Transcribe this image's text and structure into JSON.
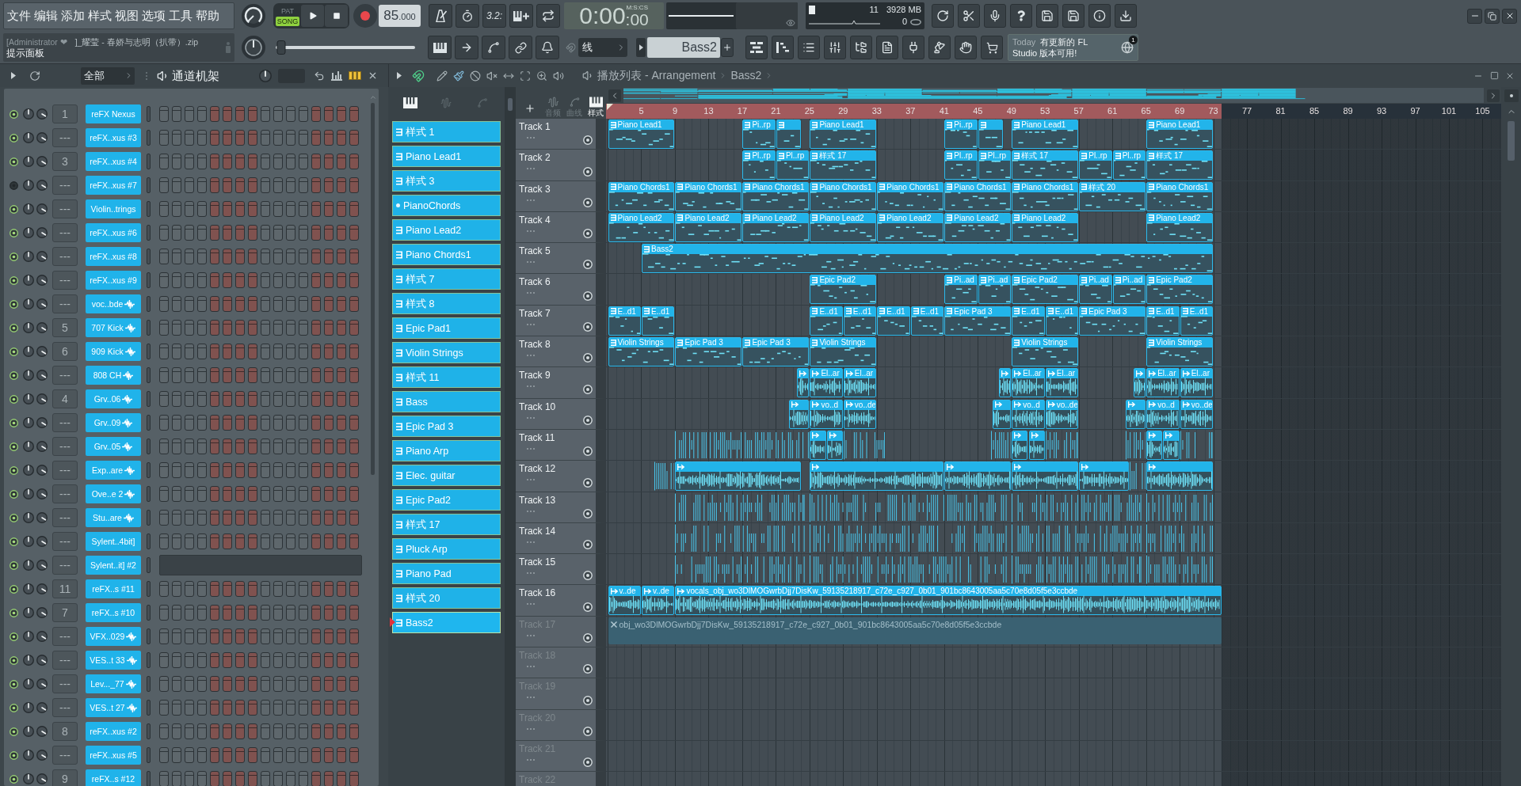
{
  "menu": [
    "文件",
    "编辑",
    "添加",
    "样式",
    "视图",
    "选项",
    "工具",
    "帮助"
  ],
  "hint_panel": {
    "user": "[Administrator ❤",
    "file": "]_耀莹 - 春娇与志明（扒带）.zip",
    "title": "提示面板"
  },
  "transport": {
    "modes": [
      {
        "label": "PAT",
        "selected": false
      },
      {
        "label": "SONG",
        "selected": true
      }
    ],
    "tempo": "85",
    "tempo_decimals": ".000",
    "countdown": "3.2:"
  },
  "time_display": {
    "time": "0:00",
    "centiseconds": ":00",
    "format": "M:S:CS"
  },
  "monitor": {
    "cpu": "11",
    "memory": "3928 MB",
    "polyphony": "0"
  },
  "master_slider": {
    "level": 0.04
  },
  "snap": "线",
  "pattern_selector": "Bass2",
  "news": {
    "day": "Today",
    "lines": [
      "有更新的 FL",
      "Studio 版本可用!"
    ],
    "badge": "1"
  },
  "channel_rack": {
    "filter": "全部",
    "title": "通道机架",
    "channels": [
      {
        "name": "reFX Nexus",
        "mixer_track": "1",
        "kind": "plugin",
        "enabled": true
      },
      {
        "name": "reFX..xus #3",
        "mixer_track": "---",
        "kind": "plugin",
        "enabled": true
      },
      {
        "name": "reFX..xus #4",
        "mixer_track": "3",
        "kind": "plugin",
        "enabled": true
      },
      {
        "name": "reFX..xus #7",
        "mixer_track": "---",
        "kind": "plugin",
        "enabled": false
      },
      {
        "name": "Violin..trings",
        "mixer_track": "---",
        "kind": "plugin",
        "enabled": true
      },
      {
        "name": "reFX..xus #6",
        "mixer_track": "---",
        "kind": "plugin",
        "enabled": true
      },
      {
        "name": "reFX..xus #8",
        "mixer_track": "---",
        "kind": "plugin",
        "enabled": true
      },
      {
        "name": "reFX..xus #9",
        "mixer_track": "---",
        "kind": "plugin",
        "enabled": true
      },
      {
        "name": "voc..bde",
        "mixer_track": "---",
        "kind": "sample",
        "enabled": true
      },
      {
        "name": "707 Kick",
        "mixer_track": "5",
        "kind": "sample",
        "enabled": true
      },
      {
        "name": "909 Kick",
        "mixer_track": "6",
        "kind": "sample",
        "enabled": true
      },
      {
        "name": "808 CH",
        "mixer_track": "---",
        "kind": "sample",
        "enabled": true
      },
      {
        "name": "Grv..06",
        "mixer_track": "4",
        "kind": "sample",
        "enabled": true
      },
      {
        "name": "Grv..09",
        "mixer_track": "---",
        "kind": "sample",
        "enabled": true
      },
      {
        "name": "Grv..05",
        "mixer_track": "---",
        "kind": "sample",
        "enabled": true
      },
      {
        "name": "Exp..are",
        "mixer_track": "---",
        "kind": "sample",
        "enabled": true
      },
      {
        "name": "Ove..e 2",
        "mixer_track": "---",
        "kind": "sample",
        "enabled": true
      },
      {
        "name": "Stu..are",
        "mixer_track": "---",
        "kind": "sample",
        "enabled": true
      },
      {
        "name": "Sylent..4bit]",
        "mixer_track": "---",
        "kind": "plugin",
        "enabled": true
      },
      {
        "name": "Sylent..it] #2",
        "mixer_track": "---",
        "kind": "pianoroll",
        "enabled": true
      },
      {
        "name": "reFX..s #11",
        "mixer_track": "11",
        "kind": "plugin",
        "enabled": true
      },
      {
        "name": "reFX..s #10",
        "mixer_track": "7",
        "kind": "plugin",
        "enabled": true
      },
      {
        "name": "VFX..029",
        "mixer_track": "---",
        "kind": "sample",
        "enabled": true
      },
      {
        "name": "VES..t 33",
        "mixer_track": "---",
        "kind": "sample",
        "enabled": true
      },
      {
        "name": "Lev..._77",
        "mixer_track": "---",
        "kind": "sample",
        "enabled": true
      },
      {
        "name": "VES..t 27",
        "mixer_track": "---",
        "kind": "sample",
        "enabled": true
      },
      {
        "name": "reFX..xus #2",
        "mixer_track": "8",
        "kind": "plugin",
        "enabled": true
      },
      {
        "name": "reFX..xus #5",
        "mixer_track": "---",
        "kind": "plugin",
        "enabled": true
      },
      {
        "name": "reFX..s #12",
        "mixer_track": "9",
        "kind": "plugin",
        "enabled": true
      }
    ]
  },
  "pattern_panel": {
    "view_tabs": [
      {
        "kind": "pattern",
        "selected": true
      },
      {
        "kind": "audio",
        "selected": false
      },
      {
        "kind": "automation",
        "selected": false
      }
    ],
    "patterns": [
      {
        "label": "样式 1",
        "kind": "pattern",
        "selected": false
      },
      {
        "label": "Piano Lead1",
        "kind": "pattern",
        "selected": false
      },
      {
        "label": "样式 3",
        "kind": "pattern",
        "selected": false
      },
      {
        "label": "PianoChords",
        "kind": "dot",
        "selected": false
      },
      {
        "label": "Piano Lead2",
        "kind": "pattern",
        "selected": false
      },
      {
        "label": "Piano Chords1",
        "kind": "pattern",
        "selected": false
      },
      {
        "label": "样式 7",
        "kind": "pattern",
        "selected": false
      },
      {
        "label": "样式 8",
        "kind": "pattern",
        "selected": false
      },
      {
        "label": "Epic Pad1",
        "kind": "pattern",
        "selected": false
      },
      {
        "label": "Violin Strings",
        "kind": "pattern",
        "selected": false
      },
      {
        "label": "样式 11",
        "kind": "pattern",
        "selected": false
      },
      {
        "label": "Bass",
        "kind": "pattern",
        "selected": false
      },
      {
        "label": "Epic Pad 3",
        "kind": "pattern",
        "selected": false
      },
      {
        "label": "Piano Arp",
        "kind": "pattern",
        "selected": false
      },
      {
        "label": "Elec. guitar",
        "kind": "pattern",
        "selected": false
      },
      {
        "label": "Epic Pad2",
        "kind": "pattern",
        "selected": false
      },
      {
        "label": "样式 17",
        "kind": "pattern",
        "selected": false
      },
      {
        "label": "Pluck Arp",
        "kind": "pattern",
        "selected": false
      },
      {
        "label": "Piano Pad",
        "kind": "pattern",
        "selected": false
      },
      {
        "label": "样式 20",
        "kind": "pattern",
        "selected": false
      },
      {
        "label": "Bass2",
        "kind": "pattern",
        "selected": true
      }
    ]
  },
  "playlist": {
    "title": "播放列表 - Arrangement",
    "pattern": "Bass2",
    "view_tabs": [
      {
        "label": "音频",
        "kind": "audio",
        "selected": false
      },
      {
        "label": "曲线",
        "kind": "automation",
        "selected": false
      },
      {
        "label": "样式",
        "kind": "pattern",
        "selected": true
      }
    ],
    "ruler": [
      "5",
      "9",
      "13",
      "17",
      "21",
      "25",
      "29",
      "33",
      "37",
      "41",
      "45",
      "49",
      "53",
      "57",
      "61",
      "65",
      "69",
      "73",
      "77",
      "81",
      "85",
      "89",
      "93",
      "97",
      "101",
      "105"
    ],
    "tracks": [
      {
        "name": "Track 1",
        "dimmed": false,
        "clips": [
          {
            "kind": "pattern",
            "label": "Piano Lead1"
          },
          {
            "kind": "pattern",
            "label": "Pi..rp"
          },
          {
            "kind": "pattern"
          },
          {
            "kind": "pattern",
            "label": "Piano Lead1"
          },
          {
            "kind": "pattern",
            "label": "Pi..rp"
          },
          {
            "kind": "pattern"
          },
          {
            "kind": "pattern",
            "label": "Piano Lead1"
          },
          {
            "kind": "pattern",
            "label": "Piano Lead1"
          }
        ]
      },
      {
        "name": "Track 2",
        "dimmed": false,
        "clips": [
          {
            "kind": "pattern",
            "label": "Pl..rp"
          },
          {
            "kind": "pattern",
            "label": "Pl..rp"
          },
          {
            "kind": "pattern",
            "label": "样式 17"
          },
          {
            "kind": "pattern",
            "label": "Pl..rp"
          },
          {
            "kind": "pattern",
            "label": "Pl..rp"
          },
          {
            "kind": "pattern",
            "label": "样式 17"
          },
          {
            "kind": "pattern",
            "label": "Pl..rp"
          },
          {
            "kind": "pattern",
            "label": "Pl..rp"
          },
          {
            "kind": "pattern",
            "label": "样式 17"
          }
        ]
      },
      {
        "name": "Track 3",
        "dimmed": false,
        "clips": [
          {
            "kind": "pattern",
            "label": "Piano Chords1"
          },
          {
            "kind": "pattern",
            "label": "Piano Chords1"
          },
          {
            "kind": "pattern",
            "label": "Piano Chords1"
          },
          {
            "kind": "pattern",
            "label": "Piano Chords1"
          },
          {
            "kind": "pattern",
            "label": "Piano Chords1"
          },
          {
            "kind": "pattern",
            "label": "Piano Chords1"
          },
          {
            "kind": "pattern",
            "label": "Piano Chords1"
          },
          {
            "kind": "pattern",
            "label": "样式 20"
          },
          {
            "kind": "pattern",
            "label": "Piano Chords1"
          }
        ]
      },
      {
        "name": "Track 4",
        "dimmed": false,
        "clips": [
          {
            "kind": "pattern",
            "label": "Piano Lead2"
          },
          {
            "kind": "pattern",
            "label": "Piano Lead2"
          },
          {
            "kind": "pattern",
            "label": "Piano Lead2"
          },
          {
            "kind": "pattern",
            "label": "Piano Lead2"
          },
          {
            "kind": "pattern",
            "label": "Piano Lead2"
          },
          {
            "kind": "pattern",
            "label": "Piano Lead2"
          },
          {
            "kind": "pattern",
            "label": "Piano Lead2"
          },
          {
            "kind": "pattern",
            "label": "Piano Lead2"
          }
        ]
      },
      {
        "name": "Track 5",
        "dimmed": false,
        "clips": [
          {
            "kind": "pattern",
            "label": "Bass2"
          }
        ]
      },
      {
        "name": "Track 6",
        "dimmed": false,
        "clips": [
          {
            "kind": "pattern",
            "label": "Epic Pad2"
          },
          {
            "kind": "pattern",
            "label": "Pi..ad"
          },
          {
            "kind": "pattern",
            "label": "Pi..ad"
          },
          {
            "kind": "pattern",
            "label": "Epic Pad2"
          },
          {
            "kind": "pattern",
            "label": "Pi..ad"
          },
          {
            "kind": "pattern",
            "label": "Pi..ad"
          },
          {
            "kind": "pattern",
            "label": "Epic Pad2"
          }
        ]
      },
      {
        "name": "Track 7",
        "dimmed": false,
        "clips": [
          {
            "kind": "pattern",
            "label": "E..d1"
          },
          {
            "kind": "pattern",
            "label": "E..d1"
          },
          {
            "kind": "pattern",
            "label": "E..d1"
          },
          {
            "kind": "pattern",
            "label": "E..d1"
          },
          {
            "kind": "pattern",
            "label": "E..d1"
          },
          {
            "kind": "pattern",
            "label": "E..d1"
          },
          {
            "kind": "pattern",
            "label": "Epic Pad 3"
          },
          {
            "kind": "pattern",
            "label": "E..d1"
          },
          {
            "kind": "pattern",
            "label": "E..d1"
          },
          {
            "kind": "pattern",
            "label": "Epic Pad 3"
          },
          {
            "kind": "pattern",
            "label": "E..d1"
          },
          {
            "kind": "pattern",
            "label": "E..d1"
          }
        ]
      },
      {
        "name": "Track 8",
        "dimmed": false,
        "clips": [
          {
            "kind": "pattern",
            "label": "Violin Strings"
          },
          {
            "kind": "pattern",
            "label": "Epic Pad 3"
          },
          {
            "kind": "pattern",
            "label": "Epic Pad 3"
          },
          {
            "kind": "pattern",
            "label": "Violin Strings"
          },
          {
            "kind": "pattern",
            "label": "Violin Strings"
          },
          {
            "kind": "pattern",
            "label": "Violin Strings"
          }
        ]
      },
      {
        "name": "Track 9",
        "dimmed": false,
        "clips": [
          {
            "kind": "audio"
          },
          {
            "kind": "audio",
            "label": "El..ar"
          },
          {
            "kind": "audio",
            "label": "El..ar"
          },
          {
            "kind": "audio"
          },
          {
            "kind": "audio",
            "label": "El..ar"
          },
          {
            "kind": "audio",
            "label": "El..ar"
          },
          {
            "kind": "audio"
          },
          {
            "kind": "audio",
            "label": "El..ar"
          },
          {
            "kind": "audio",
            "label": "El..ar"
          }
        ]
      },
      {
        "name": "Track 10",
        "dimmed": false,
        "clips": [
          {
            "kind": "audio"
          },
          {
            "kind": "audio",
            "label": "vo..d"
          },
          {
            "kind": "audio",
            "label": "vo..de"
          },
          {
            "kind": "audio"
          },
          {
            "kind": "audio",
            "label": "vo..d"
          },
          {
            "kind": "audio",
            "label": "vo..de"
          },
          {
            "kind": "audio"
          },
          {
            "kind": "audio",
            "label": "vo..d"
          },
          {
            "kind": "audio",
            "label": "vo..de"
          }
        ]
      },
      {
        "name": "Track 11",
        "dimmed": false,
        "clips": [
          {
            "kind": "slices"
          },
          {
            "kind": "audio"
          },
          {
            "kind": "audio"
          },
          {
            "kind": "slices"
          },
          {
            "kind": "slices"
          },
          {
            "kind": "audio"
          },
          {
            "kind": "audio"
          },
          {
            "kind": "slices"
          },
          {
            "kind": "slices"
          },
          {
            "kind": "audio"
          },
          {
            "kind": "audio"
          },
          {
            "kind": "slices"
          }
        ]
      },
      {
        "name": "Track 12",
        "dimmed": false,
        "clips": [
          {
            "kind": "slices"
          },
          {
            "kind": "audio"
          },
          {
            "kind": "audio"
          },
          {
            "kind": "audio"
          },
          {
            "kind": "audio"
          },
          {
            "kind": "audio"
          },
          {
            "kind": "slices"
          },
          {
            "kind": "audio"
          }
        ]
      },
      {
        "name": "Track 13",
        "dimmed": false,
        "clips": [
          {
            "kind": "slices"
          },
          {
            "kind": "slices"
          },
          {
            "kind": "slices"
          },
          {
            "kind": "slices"
          }
        ]
      },
      {
        "name": "Track 14",
        "dimmed": false,
        "clips": [
          {
            "kind": "slices"
          },
          {
            "kind": "slices"
          },
          {
            "kind": "slices"
          },
          {
            "kind": "slices"
          }
        ]
      },
      {
        "name": "Track 15",
        "dimmed": false,
        "clips": [
          {
            "kind": "slices"
          },
          {
            "kind": "slices"
          },
          {
            "kind": "slices"
          },
          {
            "kind": "slices"
          }
        ]
      },
      {
        "name": "Track 16",
        "dimmed": false,
        "clips": [
          {
            "kind": "audio",
            "label": "v..de"
          },
          {
            "kind": "audio",
            "label": "v..de"
          },
          {
            "kind": "audio",
            "label": "vocals_obj_wo3DlMOGwrbDjj7DisKw_59135218917_c72e_c927_0b01_901bc8643005aa5c70e8d05f5e3ccbde"
          }
        ]
      },
      {
        "name": "Track 17",
        "dimmed": true,
        "clips": [
          {
            "kind": "muted",
            "label": "obj_wo3DlMOGwrbDjj7DisKw_59135218917_c72e_c927_0b01_901bc8643005aa5c70e8d05f5e3ccbde"
          }
        ]
      },
      {
        "name": "Track 18",
        "dimmed": true
      },
      {
        "name": "Track 19",
        "dimmed": true
      },
      {
        "name": "Track 20",
        "dimmed": true
      },
      {
        "name": "Track 21",
        "dimmed": true
      },
      {
        "name": "Track 22",
        "dimmed": true
      }
    ]
  }
}
